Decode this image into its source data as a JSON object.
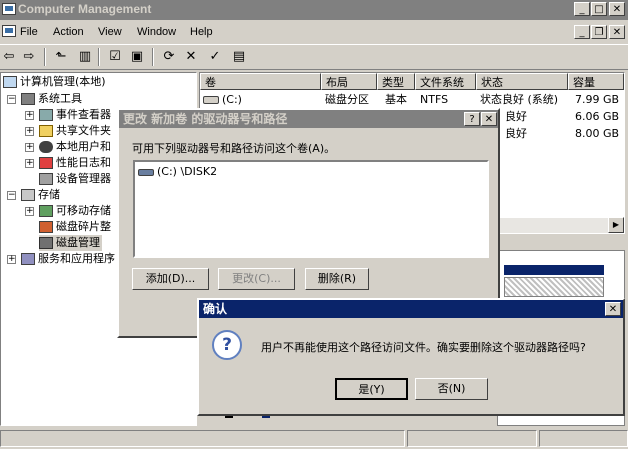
{
  "window": {
    "title": "Computer Management"
  },
  "menu": {
    "file": "File",
    "action": "Action",
    "view": "View",
    "window": "Window",
    "help": "Help"
  },
  "tree": {
    "root": "计算机管理(本地)",
    "system_tools": "系统工具",
    "event_viewer": "事件查看器",
    "shared_folders": "共享文件夹",
    "local_users": "本地用户和",
    "perf_logs": "性能日志和",
    "device_manager": "设备管理器",
    "storage": "存储",
    "removable_storage": "可移动存储",
    "defrag": "磁盘碎片整",
    "disk_management": "磁盘管理",
    "services": "服务和应用程序"
  },
  "volumes": {
    "headers": {
      "volume": "卷",
      "layout": "布局",
      "type": "类型",
      "fs": "文件系统",
      "status": "状态",
      "capacity": "容量"
    },
    "rows": [
      {
        "volume": "(C:)",
        "layout": "磁盘分区",
        "type": "基本",
        "fs": "NTFS",
        "status": "状态良好 (系统)",
        "capacity": "7.99 GB"
      },
      {
        "status": "良好",
        "capacity": "6.06 GB"
      },
      {
        "status": "良好",
        "capacity": "8.00 GB"
      }
    ]
  },
  "change_dialog": {
    "title": "更改 新加卷 的驱动器号和路径",
    "help": "?",
    "instruction": "可用下列驱动器号和路径访问这个卷(A)。",
    "path_item": "(C:) \\DISK2",
    "add": "添加(D)...",
    "change": "更改(C)...",
    "delete": "删除(R)"
  },
  "confirm_dialog": {
    "title": "确认",
    "question_icon": "?",
    "message": "用户不再能使用这个路径访问文件。确实要删除这个驱动器路径吗?",
    "yes": "是(Y)",
    "no": "否(N)"
  },
  "colors": {
    "active_title": "#0a246a",
    "inactive_title": "#808080",
    "disk_bar": "#0a246a"
  }
}
